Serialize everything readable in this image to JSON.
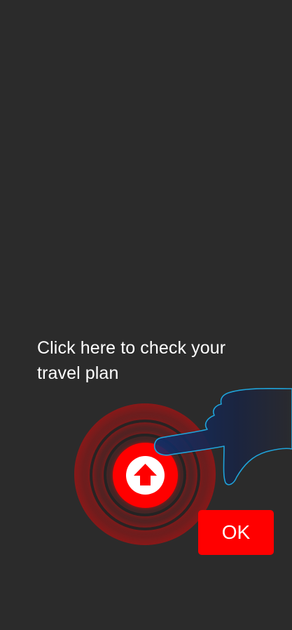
{
  "coach_mark": {
    "message": "Click here to check your travel plan",
    "target_icon": "arrow-up-icon",
    "pointer_icon": "pointing-hand-icon",
    "ok_label": "OK"
  },
  "colors": {
    "background": "#2b2b2b",
    "accent": "#ff0000",
    "hand_outline": "#1fa3d9",
    "hand_fill": "#1e2a44",
    "text": "#ffffff"
  }
}
